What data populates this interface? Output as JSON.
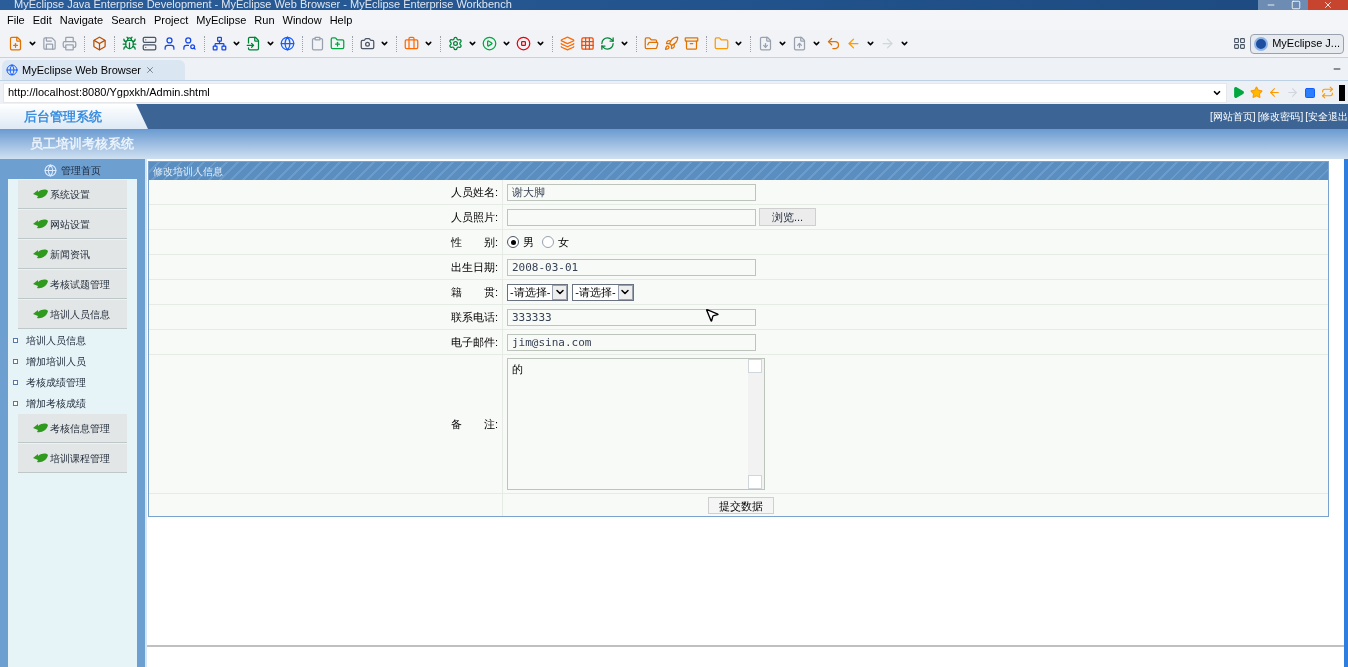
{
  "window": {
    "title": "MyEclipse Java Enterprise Development - MyEclipse Web Browser - MyEclipse Enterprise Workbench"
  },
  "menu": [
    "File",
    "Edit",
    "Navigate",
    "Search",
    "Project",
    "MyEclipse",
    "Run",
    "Window",
    "Help"
  ],
  "perspective": {
    "label": "MyEclipse J..."
  },
  "tab": {
    "label": "MyEclipse Web Browser"
  },
  "address": {
    "value": "http://localhost:8080/Ygpxkh/Admin.shtml"
  },
  "site": {
    "logo": "后台管理系统",
    "subtitle": "员工培训考核系统",
    "top_links": [
      "[网站首页]",
      "[修改密码]",
      "[安全退出"
    ]
  },
  "sidebar": {
    "home": "管理首页",
    "items": [
      {
        "kind": "section",
        "label": "系统设置"
      },
      {
        "kind": "section",
        "label": "网站设置"
      },
      {
        "kind": "section",
        "label": "新闻资讯"
      },
      {
        "kind": "section",
        "label": "考核试题管理"
      },
      {
        "kind": "section",
        "label": "培训人员信息"
      },
      {
        "kind": "link",
        "label": "培训人员信息"
      },
      {
        "kind": "link",
        "label": "增加培训人员"
      },
      {
        "kind": "link",
        "label": "考核成绩管理"
      },
      {
        "kind": "link",
        "label": "增加考核成绩"
      },
      {
        "kind": "section",
        "label": "考核信息管理"
      },
      {
        "kind": "section",
        "label": "培训课程管理"
      }
    ]
  },
  "form": {
    "title": "修改培训人信息",
    "fields": [
      {
        "kind": "text",
        "label": "人员姓名:",
        "value": "谢大脚"
      },
      {
        "kind": "file",
        "label": "人员照片:",
        "button": "浏览..."
      },
      {
        "kind": "radio",
        "label": "性　　别:",
        "options": [
          {
            "label": "男",
            "selected": true
          },
          {
            "label": "女",
            "selected": false
          }
        ]
      },
      {
        "kind": "text",
        "label": "出生日期:",
        "value": "2008-03-01"
      },
      {
        "kind": "select",
        "label": "籍　　贯:",
        "selects": [
          "-请选择-",
          "-请选择-"
        ]
      },
      {
        "kind": "text",
        "label": "联系电话:",
        "value": "333333"
      },
      {
        "kind": "text",
        "label": "电子邮件:",
        "value": "jim@sina.com"
      },
      {
        "kind": "textarea",
        "label": "备　　注:",
        "value": "的"
      }
    ],
    "submit": "提交数据"
  }
}
